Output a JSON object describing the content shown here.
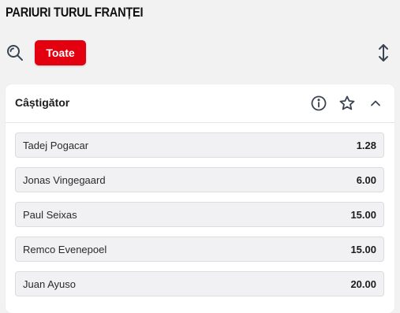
{
  "page": {
    "title": "PARIURI TURUL FRANȚEI"
  },
  "toolbar": {
    "search_icon": "search-icon",
    "filter_label": "Toate",
    "sort_icon": "sort-arrows-icon"
  },
  "colors": {
    "accent": "#e3000f",
    "background": "#f2f2f3",
    "card": "#ffffff",
    "row": "#f1f1f3"
  },
  "market": {
    "title": "Câștigător",
    "icons": [
      "info-icon",
      "star-icon",
      "chevron-up-icon"
    ],
    "selections": [
      {
        "name": "Tadej Pogacar",
        "odds": "1.28"
      },
      {
        "name": "Jonas Vingegaard",
        "odds": "6.00"
      },
      {
        "name": "Paul Seixas",
        "odds": "15.00"
      },
      {
        "name": "Remco Evenepoel",
        "odds": "15.00"
      },
      {
        "name": "Juan Ayuso",
        "odds": "20.00"
      }
    ]
  }
}
